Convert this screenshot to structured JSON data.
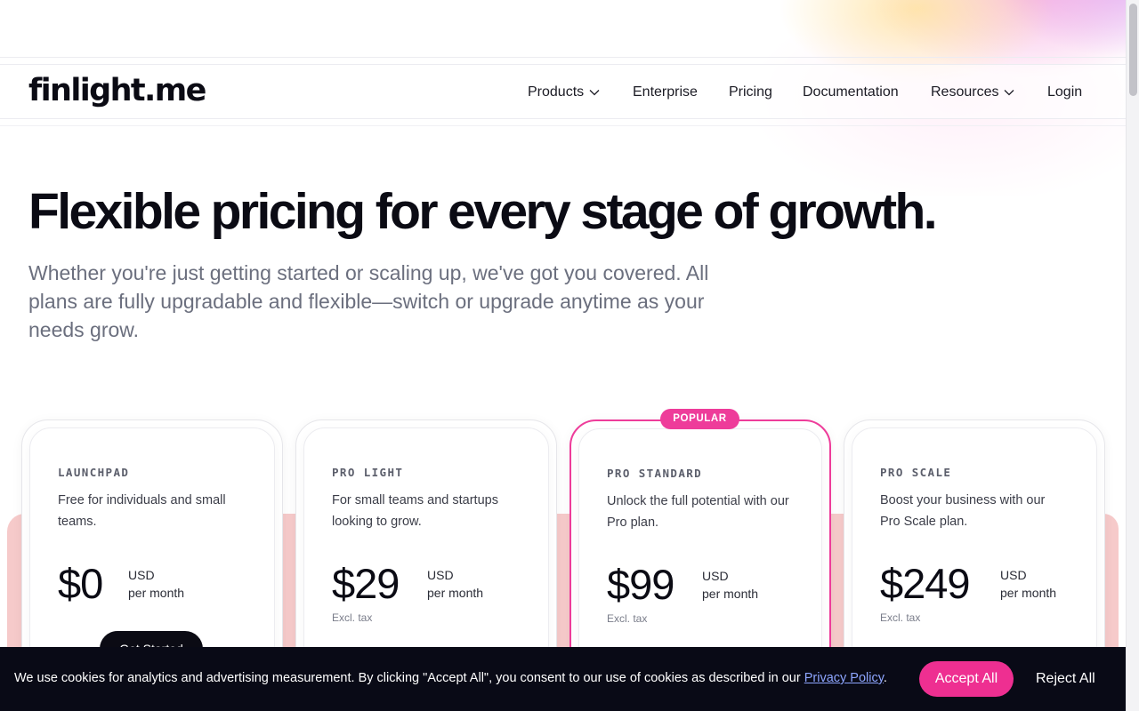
{
  "brand": {
    "logo_text": "finlight.me"
  },
  "nav": {
    "items": [
      {
        "label": "Products",
        "dropdown": true
      },
      {
        "label": "Enterprise",
        "dropdown": false
      },
      {
        "label": "Pricing",
        "dropdown": false
      },
      {
        "label": "Documentation",
        "dropdown": false
      },
      {
        "label": "Resources",
        "dropdown": true
      },
      {
        "label": "Login",
        "dropdown": false
      }
    ]
  },
  "hero": {
    "title": "Flexible pricing for every stage of growth.",
    "subtitle": "Whether you're just getting started or scaling up, we've got you covered. All plans are fully upgradable and flexible—switch or upgrade anytime as your needs grow."
  },
  "plans": [
    {
      "name": "LAUNCHPAD",
      "description": "Free for individuals and small teams.",
      "price": "$0",
      "currency": "USD",
      "period": "per month",
      "tax": "",
      "cta": "Get Started"
    },
    {
      "name": "PRO LIGHT",
      "description": "For small teams and startups looking to grow.",
      "price": "$29",
      "currency": "USD",
      "period": "per month",
      "tax": "Excl. tax"
    },
    {
      "name": "PRO STANDARD",
      "description": "Unlock the full potential with our Pro plan.",
      "price": "$99",
      "currency": "USD",
      "period": "per month",
      "tax": "Excl. tax",
      "badge": "POPULAR"
    },
    {
      "name": "PRO SCALE",
      "description": "Boost your business with our Pro Scale plan.",
      "price": "$249",
      "currency": "USD",
      "period": "per month",
      "tax": "Excl. tax"
    }
  ],
  "cookie": {
    "text": "We use cookies for analytics and advertising measurement. By clicking \"Accept All\", you consent to our use of cookies as described in our ",
    "link": "Privacy Policy",
    "suffix": ".",
    "accept": "Accept All",
    "reject": "Reject All"
  },
  "colors": {
    "accent": "#ee3c9a",
    "dark": "#0b0b14",
    "band": "#f6caca"
  },
  "icons": {
    "nav_dropdown": "chevron-down-icon"
  }
}
